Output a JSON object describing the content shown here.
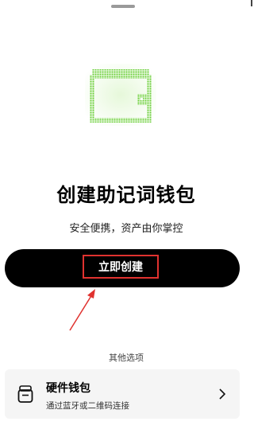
{
  "header": {
    "handle_icon": "grab-handle"
  },
  "hero": {
    "icon": "wallet-icon",
    "accent_color": "#6ccf3a",
    "title": "创建助记词钱包",
    "subtitle": "安全便携，资产由你掌控"
  },
  "primary_action": {
    "label": "立即创建",
    "background": "#000000",
    "highlight_color": "#e0322f"
  },
  "other_options": {
    "heading": "其他选项",
    "items": [
      {
        "icon": "hardware-wallet-icon",
        "title": "硬件钱包",
        "description": "通过蓝牙或二维码连接",
        "chevron_icon": "chevron-right-icon"
      }
    ]
  }
}
